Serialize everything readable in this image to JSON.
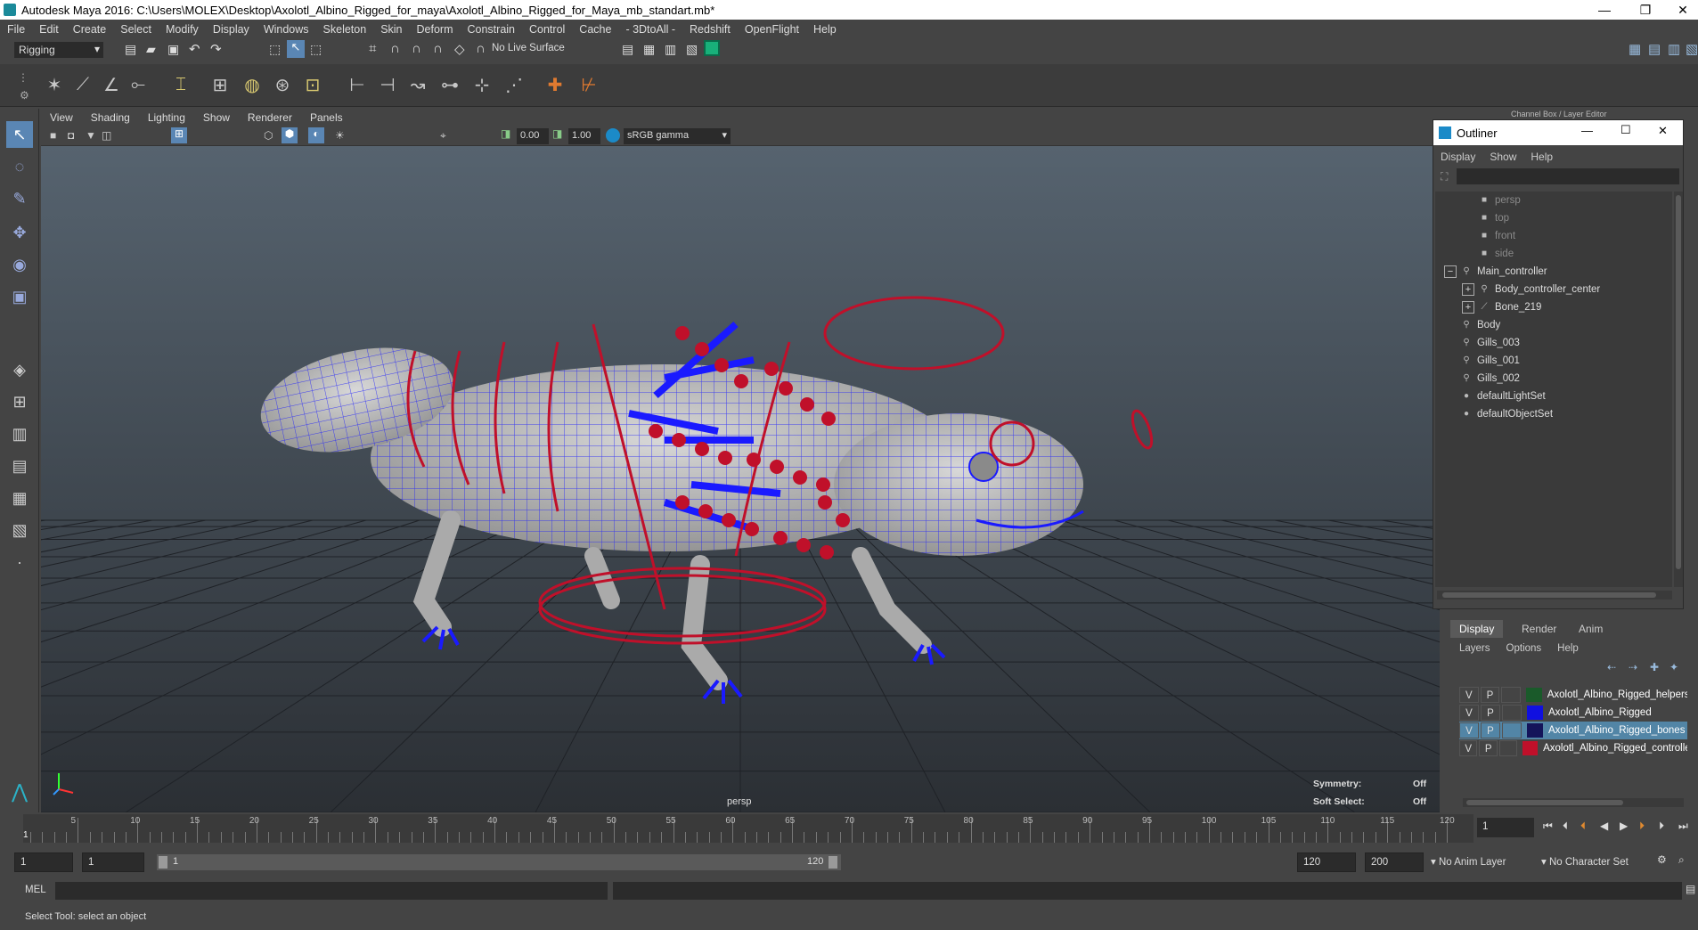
{
  "window": {
    "title": "Autodesk Maya 2016: C:\\Users\\MOLEX\\Desktop\\Axolotl_Albino_Rigged_for_maya\\Axolotl_Albino_Rigged_for_Maya_mb_standart.mb*",
    "minimize": "—",
    "restore": "❐",
    "close": "✕"
  },
  "menu": [
    "File",
    "Edit",
    "Create",
    "Select",
    "Modify",
    "Display",
    "Windows",
    "Skeleton",
    "Skin",
    "Deform",
    "Constrain",
    "Control",
    "Cache",
    "- 3DtoAll -",
    "Redshift",
    "OpenFlight",
    "Help"
  ],
  "toolbar": {
    "mode": "Rigging",
    "live_surface": "No Live Surface"
  },
  "panel": {
    "menu": [
      "View",
      "Shading",
      "Lighting",
      "Show",
      "Renderer",
      "Panels"
    ],
    "near": "0.00",
    "far": "1.00",
    "color_space": "sRGB gamma",
    "camera": "persp",
    "symmetry_label": "Symmetry:",
    "symmetry_value": "Off",
    "soft_select_label": "Soft Select:",
    "soft_select_value": "Off"
  },
  "channel_box_title": "Channel Box / Layer Editor",
  "outliner": {
    "title": "Outliner",
    "menu": [
      "Display",
      "Show",
      "Help"
    ],
    "items": [
      {
        "name": "persp",
        "indent": 2,
        "icon": "camera-icon",
        "dim": true,
        "expander": ""
      },
      {
        "name": "top",
        "indent": 2,
        "icon": "camera-icon",
        "dim": true,
        "expander": ""
      },
      {
        "name": "front",
        "indent": 2,
        "icon": "camera-icon",
        "dim": true,
        "expander": ""
      },
      {
        "name": "side",
        "indent": 2,
        "icon": "camera-icon",
        "dim": true,
        "expander": ""
      },
      {
        "name": "Main_controller",
        "indent": 1,
        "icon": "transform-icon",
        "dim": false,
        "expander": "−"
      },
      {
        "name": "Body_controller_center",
        "indent": 2,
        "icon": "transform-icon",
        "dim": false,
        "expander": "+"
      },
      {
        "name": "Bone_219",
        "indent": 2,
        "icon": "joint-icon",
        "dim": false,
        "expander": "+"
      },
      {
        "name": "Body",
        "indent": 1,
        "icon": "transform-icon",
        "dim": false,
        "expander": ""
      },
      {
        "name": "Gills_003",
        "indent": 1,
        "icon": "transform-icon",
        "dim": false,
        "expander": ""
      },
      {
        "name": "Gills_001",
        "indent": 1,
        "icon": "transform-icon",
        "dim": false,
        "expander": ""
      },
      {
        "name": "Gills_002",
        "indent": 1,
        "icon": "transform-icon",
        "dim": false,
        "expander": ""
      },
      {
        "name": "defaultLightSet",
        "indent": 1,
        "icon": "set-icon",
        "dim": false,
        "expander": ""
      },
      {
        "name": "defaultObjectSet",
        "indent": 1,
        "icon": "set-icon",
        "dim": false,
        "expander": ""
      }
    ]
  },
  "layers": {
    "tabs": [
      "Display",
      "Render",
      "Anim"
    ],
    "menu": [
      "Layers",
      "Options",
      "Help"
    ],
    "rows": [
      {
        "v": "V",
        "p": "P",
        "color": "#1a5a2a",
        "name": "Axolotl_Albino_Rigged_helpers",
        "selected": false
      },
      {
        "v": "V",
        "p": "P",
        "color": "#1010e0",
        "name": "Axolotl_Albino_Rigged",
        "selected": false
      },
      {
        "v": "V",
        "p": "P",
        "color": "#14145a",
        "name": "Axolotl_Albino_Rigged_bones",
        "selected": true
      },
      {
        "v": "V",
        "p": "P",
        "color": "#c0102a",
        "name": "Axolotl_Albino_Rigged_controllers",
        "selected": false
      }
    ]
  },
  "timeline": {
    "ticks": [
      "5",
      "10",
      "15",
      "20",
      "25",
      "30",
      "35",
      "40",
      "45",
      "50",
      "55",
      "60",
      "65",
      "70",
      "75",
      "80",
      "85",
      "90",
      "95",
      "100",
      "105",
      "110",
      "115",
      "120"
    ],
    "start_marker": "1",
    "current_frame": "1"
  },
  "range": {
    "start": "1",
    "anim_start": "1",
    "slider_start": "1",
    "slider_end": "120",
    "end": "120",
    "anim_end": "200",
    "anim_layer": "No Anim Layer",
    "character_set": "No Character Set"
  },
  "mel": {
    "label": "MEL"
  },
  "help_line": "Select Tool: select an object",
  "colors": {
    "wire": "#1a1aff",
    "controller": "#c0102a",
    "viewport_top": "#4e5a66",
    "viewport_bottom": "#2d3136"
  }
}
